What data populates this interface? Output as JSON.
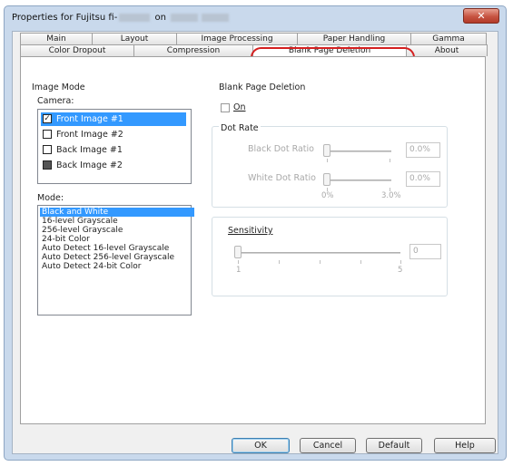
{
  "window": {
    "title_prefix": "Properties for Fujitsu fi-",
    "title_on": "on",
    "close_glyph": "✕"
  },
  "tabs_back": [
    "Main",
    "Layout",
    "Image Processing",
    "Paper Handling",
    "Gamma"
  ],
  "tabs_front": [
    "Color Dropout",
    "Compression",
    "Blank Page Deletion",
    "About"
  ],
  "image_mode": {
    "group_label": "Image Mode",
    "camera_label": "Camera:",
    "camera_items": [
      {
        "label": "Front Image #1",
        "checked": "✓"
      },
      {
        "label": "Front Image #2",
        "checked": ""
      },
      {
        "label": "Back Image #1",
        "checked": ""
      },
      {
        "label": "Back Image #2",
        "checked": ""
      }
    ],
    "mode_label": "Mode:",
    "mode_items": [
      "Black and White",
      "16-level Grayscale",
      "256-level Grayscale",
      "24-bit Color",
      "Auto Detect 16-level Grayscale",
      "Auto Detect 256-level Grayscale",
      "Auto Detect 24-bit Color"
    ]
  },
  "blank_page": {
    "group_label": "Blank Page Deletion",
    "on_label": "On",
    "dot_rate_label": "Dot Rate",
    "black_dot_label": "Black Dot Ratio",
    "black_dot_value": "0.0%",
    "white_dot_label": "White Dot Ratio",
    "white_dot_value": "0.0%",
    "scale_min": "0%",
    "scale_max": "3.0%",
    "sensitivity_label": "Sensitivity",
    "sensitivity_value": "0",
    "sens_min": "1",
    "sens_max": "5"
  },
  "buttons": {
    "ok": "OK",
    "cancel": "Cancel",
    "default": "Default",
    "help": "Help"
  },
  "colors": {
    "selection": "#3399ff",
    "highlight_ring": "#d42020",
    "close": "#c75442"
  }
}
